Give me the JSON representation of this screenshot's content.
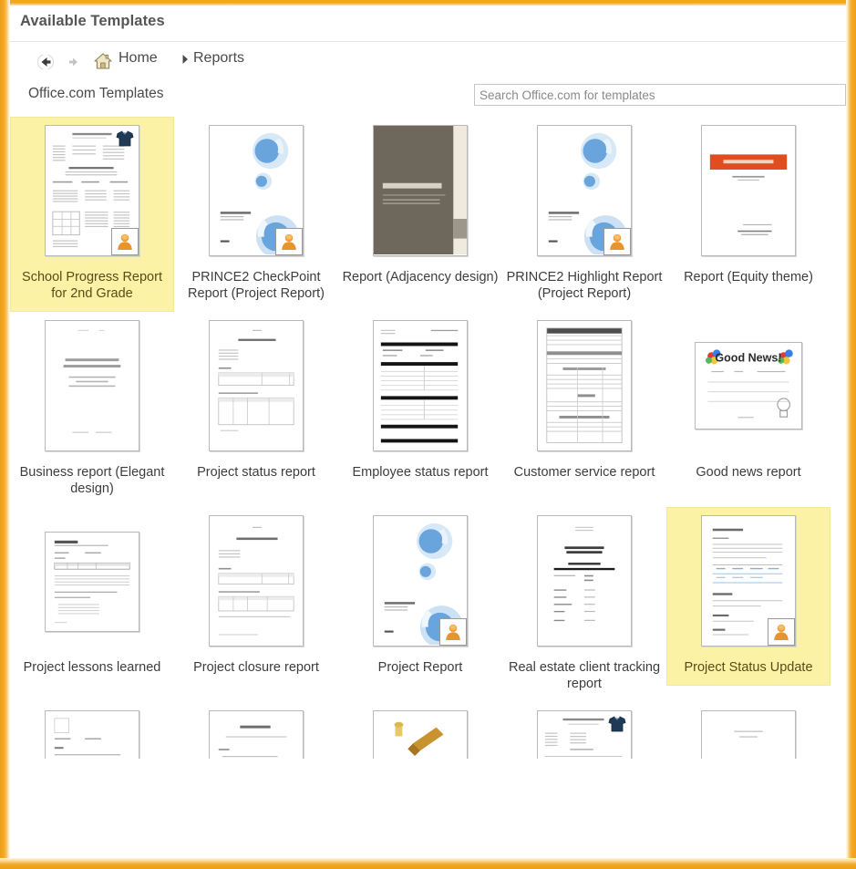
{
  "window": {
    "title": "Available Templates",
    "frame_color": "#f5a623"
  },
  "breadcrumb": {
    "back_label": "Back",
    "forward_label": "Forward",
    "home_icon": "home-icon",
    "items": [
      {
        "label": "Home"
      },
      {
        "label": "Reports"
      }
    ],
    "separator": "▸"
  },
  "section": {
    "title": "Office.com Templates"
  },
  "search": {
    "placeholder": "Search Office.com for templates",
    "value": ""
  },
  "selection": {
    "highlight_color": "#fbf2a6",
    "selected": [
      "School Progress Report for 2nd Grade",
      "Project Status Update"
    ]
  },
  "templates": {
    "rows": [
      [
        {
          "label": "School Progress Report for 2nd Grade",
          "selected": true,
          "badge": "user-badge",
          "extra_badge": "shirt-icon",
          "thumb": "form-dense"
        },
        {
          "label": "PRINCE2 CheckPoint Report (Project Report)",
          "selected": false,
          "badge": "user-badge",
          "thumb": "blue-circles"
        },
        {
          "label": "Report (Adjacency design)",
          "selected": false,
          "badge": "",
          "thumb": "adjacency"
        },
        {
          "label": "PRINCE2 Highlight Report (Project Report)",
          "selected": false,
          "badge": "user-badge",
          "thumb": "blue-circles"
        },
        {
          "label": "Report (Equity theme)",
          "selected": false,
          "badge": "",
          "thumb": "equity"
        }
      ],
      [
        {
          "label": "Business report (Elegant design)",
          "selected": false,
          "badge": "",
          "thumb": "elegant"
        },
        {
          "label": "Project status report",
          "selected": false,
          "badge": "",
          "thumb": "status-tables"
        },
        {
          "label": "Employee status report",
          "selected": false,
          "badge": "",
          "thumb": "black-bars"
        },
        {
          "label": "Customer service report",
          "selected": false,
          "badge": "",
          "thumb": "service-form"
        },
        {
          "label": "Good news report",
          "selected": false,
          "badge": "",
          "thumb": "good-news"
        }
      ],
      [
        {
          "label": "Project lessons learned",
          "selected": false,
          "badge": "",
          "thumb": "lessons"
        },
        {
          "label": "Project closure report",
          "selected": false,
          "badge": "",
          "thumb": "closure"
        },
        {
          "label": "Project Report",
          "selected": false,
          "badge": "user-badge",
          "thumb": "blue-circles"
        },
        {
          "label": "Real estate client tracking report",
          "selected": false,
          "badge": "",
          "thumb": "realestate"
        },
        {
          "label": "Project Status Update",
          "selected": true,
          "badge": "user-badge",
          "thumb": "status-update"
        }
      ],
      [
        {
          "label": "",
          "selected": false,
          "badge": "",
          "thumb": "partial-a"
        },
        {
          "label": "",
          "selected": false,
          "badge": "",
          "thumb": "partial-b"
        },
        {
          "label": "",
          "selected": false,
          "badge": "",
          "thumb": "partial-c"
        },
        {
          "label": "",
          "selected": false,
          "badge": "shirt-icon",
          "thumb": "partial-d"
        },
        {
          "label": "",
          "selected": false,
          "badge": "",
          "thumb": "partial-e"
        }
      ]
    ]
  },
  "thumb_text": {
    "adjacency_title": "[Type the document title]",
    "equity_title": "[Type the document title]",
    "good_news_title": "Good News!",
    "elegant_title": "PROPOSAL AND MARKETING PLAN",
    "realestate_title": "Real Estate Client Tracking Report",
    "realestate_sub": "[Client Name]"
  }
}
